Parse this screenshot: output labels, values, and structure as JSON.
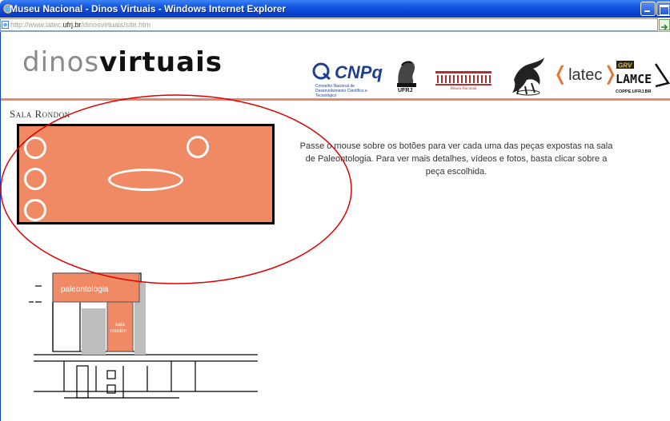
{
  "window": {
    "title": "Museu Nacional - Dinos Virtuais - Windows Internet Explorer",
    "address": {
      "prefix": "http://www.latec.",
      "domain": "ufrj.br",
      "suffix": "/dinosvirtuais/site.htm"
    }
  },
  "header": {
    "logo_part1": "dinos",
    "logo_part2": "virtuais",
    "partners": {
      "cnpq": "CNPq",
      "cnpq_sub": "Conselho Nacional de Desenvolvimento Científico e Tecnológico",
      "ufrj": "UFRJ",
      "museu": "Museu Nacional",
      "latec": "latec",
      "lamce_grv": "GRV",
      "lamce": "LAMCE",
      "lamce_sub": "COPPE.UFRJ.BR"
    },
    "accent_color": "#e8876b"
  },
  "content": {
    "room_title": "Sala Rondon",
    "room_color": "#ef8a64",
    "instructions": "Passe o mouse sobre os botões para ver cada uma das peças expostas na sala de Paleontologia. Para ver mais detalhes, vídeos e fotos, basta clicar sobre a peça escolhida.",
    "floorplan": {
      "paleontologia": "paleontologia",
      "sala_line1": "sala",
      "sala_line2": "rondon"
    }
  }
}
